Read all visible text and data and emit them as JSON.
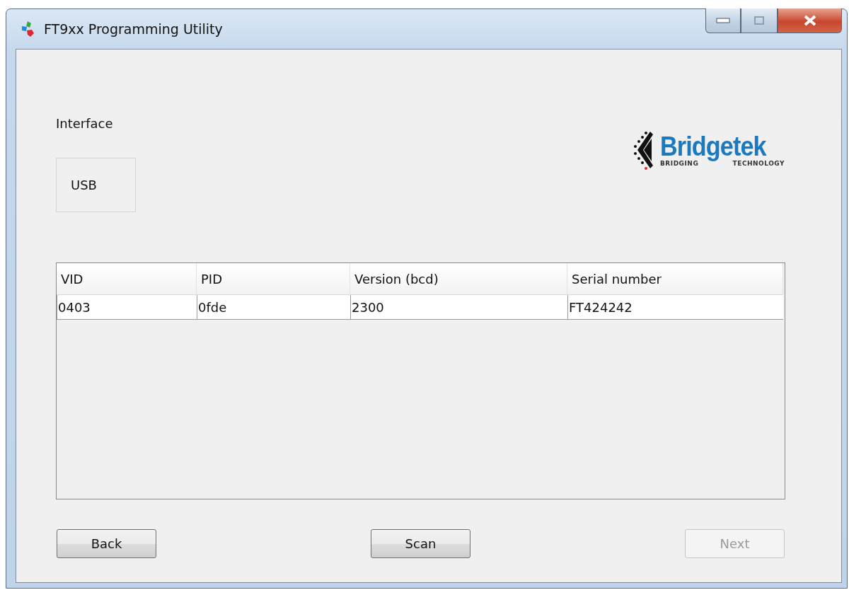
{
  "window": {
    "title": "FT9xx Programming Utility"
  },
  "logo": {
    "name": "Bridgetek",
    "tagline_left": "BRIDGING",
    "tagline_right": "TECHNOLOGY"
  },
  "interface": {
    "label": "Interface",
    "options": [
      {
        "label": "USB",
        "selected": false
      }
    ]
  },
  "table": {
    "columns": [
      "VID",
      "PID",
      "Version (bcd)",
      "Serial number"
    ],
    "rows": [
      {
        "cells": [
          "0403",
          "0fde",
          "2300",
          "FT424242"
        ],
        "selected": false
      }
    ]
  },
  "buttons": [
    {
      "label": "Back",
      "disabled": false
    },
    {
      "label": "Scan",
      "disabled": false
    },
    {
      "label": "Next",
      "disabled": true
    }
  ]
}
